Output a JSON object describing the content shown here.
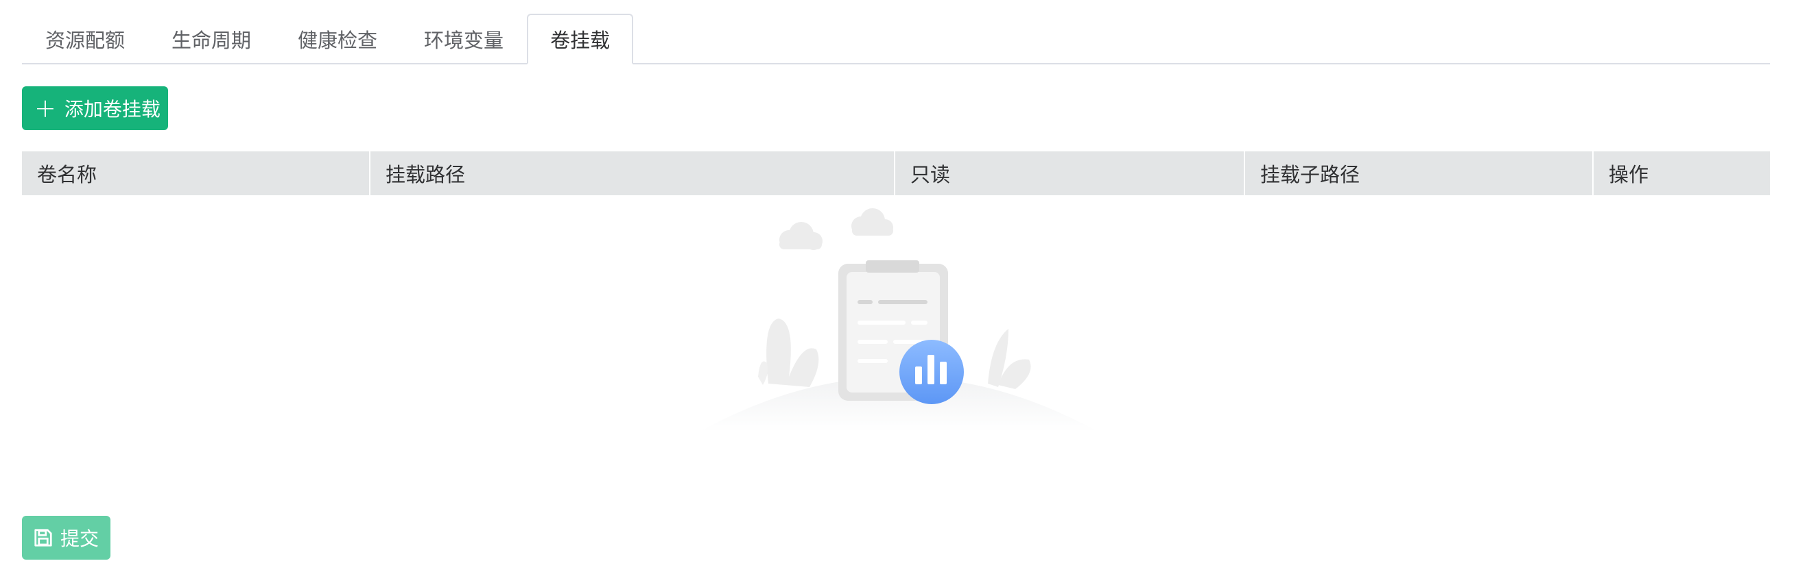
{
  "tabs": [
    {
      "label": "资源配额",
      "active": false
    },
    {
      "label": "生命周期",
      "active": false
    },
    {
      "label": "健康检查",
      "active": false
    },
    {
      "label": "环境变量",
      "active": false
    },
    {
      "label": "卷挂载",
      "active": true
    }
  ],
  "toolbar": {
    "add_icon": "plus-icon",
    "add_label": "添加卷挂载"
  },
  "table": {
    "columns": [
      "卷名称",
      "挂载路径",
      "只读",
      "挂载子路径",
      "操作"
    ],
    "rows": []
  },
  "empty_state": {
    "icon": "empty-clipboard-chart-illustration"
  },
  "footer": {
    "submit_icon": "save-icon",
    "submit_label": "提交"
  },
  "colors": {
    "primary": "#16b37a",
    "primary_disabled": "#63cfa5",
    "table_header_bg": "#e3e5e6",
    "tab_border": "#dcdfe6",
    "chart_badge": "#6ea8ff"
  }
}
